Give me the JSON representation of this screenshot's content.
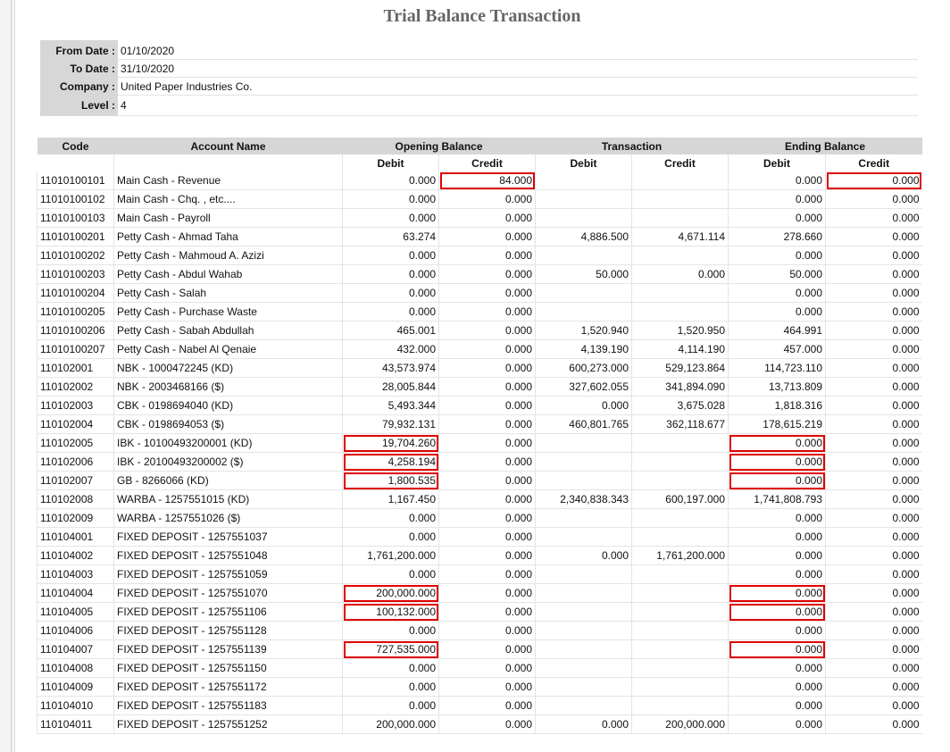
{
  "report": {
    "title": "Trial Balance Transaction"
  },
  "params": [
    {
      "label": "From Date :",
      "value": "01/10/2020"
    },
    {
      "label": "To Date :",
      "value": "31/10/2020"
    },
    {
      "label": "Company :",
      "value": "United Paper Industries Co."
    },
    {
      "label": "Level :",
      "value": "4"
    }
  ],
  "table": {
    "headers": {
      "code": "Code",
      "account": "Account Name",
      "opening": "Opening Balance",
      "transaction": "Transaction",
      "ending": "Ending Balance"
    },
    "subheaders": {
      "debit": "Debit",
      "credit": "Credit"
    },
    "rows": [
      {
        "code": "11010100101",
        "name": "Main Cash - Revenue",
        "od": "0.000",
        "oc": "84.000",
        "td": "",
        "tc": "",
        "ed": "0.000",
        "ec": "0.000"
      },
      {
        "code": "11010100102",
        "name": "Main Cash - Chq. , etc....",
        "od": "0.000",
        "oc": "0.000",
        "td": "",
        "tc": "",
        "ed": "0.000",
        "ec": "0.000"
      },
      {
        "code": "11010100103",
        "name": "Main Cash - Payroll",
        "od": "0.000",
        "oc": "0.000",
        "td": "",
        "tc": "",
        "ed": "0.000",
        "ec": "0.000"
      },
      {
        "code": "11010100201",
        "name": "Petty Cash - Ahmad Taha",
        "od": "63.274",
        "oc": "0.000",
        "td": "4,886.500",
        "tc": "4,671.114",
        "ed": "278.660",
        "ec": "0.000"
      },
      {
        "code": "11010100202",
        "name": "Petty Cash - Mahmoud A. Azizi",
        "od": "0.000",
        "oc": "0.000",
        "td": "",
        "tc": "",
        "ed": "0.000",
        "ec": "0.000"
      },
      {
        "code": "11010100203",
        "name": "Petty Cash - Abdul Wahab",
        "od": "0.000",
        "oc": "0.000",
        "td": "50.000",
        "tc": "0.000",
        "ed": "50.000",
        "ec": "0.000"
      },
      {
        "code": "11010100204",
        "name": "Petty Cash - Salah",
        "od": "0.000",
        "oc": "0.000",
        "td": "",
        "tc": "",
        "ed": "0.000",
        "ec": "0.000"
      },
      {
        "code": "11010100205",
        "name": "Petty Cash - Purchase Waste",
        "od": "0.000",
        "oc": "0.000",
        "td": "",
        "tc": "",
        "ed": "0.000",
        "ec": "0.000"
      },
      {
        "code": "11010100206",
        "name": "Petty Cash - Sabah Abdullah",
        "od": "465.001",
        "oc": "0.000",
        "td": "1,520.940",
        "tc": "1,520.950",
        "ed": "464.991",
        "ec": "0.000"
      },
      {
        "code": "11010100207",
        "name": "Petty Cash - Nabel Al Qenaie",
        "od": "432.000",
        "oc": "0.000",
        "td": "4,139.190",
        "tc": "4,114.190",
        "ed": "457.000",
        "ec": "0.000"
      },
      {
        "code": "110102001",
        "name": "NBK - 1000472245 (KD)",
        "od": "43,573.974",
        "oc": "0.000",
        "td": "600,273.000",
        "tc": "529,123.864",
        "ed": "114,723.110",
        "ec": "0.000"
      },
      {
        "code": "110102002",
        "name": "NBK - 2003468166 ($)",
        "od": "28,005.844",
        "oc": "0.000",
        "td": "327,602.055",
        "tc": "341,894.090",
        "ed": "13,713.809",
        "ec": "0.000"
      },
      {
        "code": "110102003",
        "name": "CBK - 0198694040 (KD)",
        "od": "5,493.344",
        "oc": "0.000",
        "td": "0.000",
        "tc": "3,675.028",
        "ed": "1,818.316",
        "ec": "0.000"
      },
      {
        "code": "110102004",
        "name": "CBK - 0198694053 ($)",
        "od": "79,932.131",
        "oc": "0.000",
        "td": "460,801.765",
        "tc": "362,118.677",
        "ed": "178,615.219",
        "ec": "0.000"
      },
      {
        "code": "110102005",
        "name": "IBK - 10100493200001 (KD)",
        "od": "19,704.260",
        "oc": "0.000",
        "td": "",
        "tc": "",
        "ed": "0.000",
        "ec": "0.000"
      },
      {
        "code": "110102006",
        "name": "IBK - 20100493200002 ($)",
        "od": "4,258.194",
        "oc": "0.000",
        "td": "",
        "tc": "",
        "ed": "0.000",
        "ec": "0.000"
      },
      {
        "code": "110102007",
        "name": "GB - 8266066 (KD)",
        "od": "1,800.535",
        "oc": "0.000",
        "td": "",
        "tc": "",
        "ed": "0.000",
        "ec": "0.000"
      },
      {
        "code": "110102008",
        "name": "WARBA - 1257551015 (KD)",
        "od": "1,167.450",
        "oc": "0.000",
        "td": "2,340,838.343",
        "tc": "600,197.000",
        "ed": "1,741,808.793",
        "ec": "0.000"
      },
      {
        "code": "110102009",
        "name": "WARBA - 1257551026 ($)",
        "od": "0.000",
        "oc": "0.000",
        "td": "",
        "tc": "",
        "ed": "0.000",
        "ec": "0.000"
      },
      {
        "code": "110104001",
        "name": "FIXED DEPOSIT - 1257551037",
        "od": "0.000",
        "oc": "0.000",
        "td": "",
        "tc": "",
        "ed": "0.000",
        "ec": "0.000"
      },
      {
        "code": "110104002",
        "name": "FIXED DEPOSIT - 1257551048",
        "od": "1,761,200.000",
        "oc": "0.000",
        "td": "0.000",
        "tc": "1,761,200.000",
        "ed": "0.000",
        "ec": "0.000"
      },
      {
        "code": "110104003",
        "name": "FIXED DEPOSIT - 1257551059",
        "od": "0.000",
        "oc": "0.000",
        "td": "",
        "tc": "",
        "ed": "0.000",
        "ec": "0.000"
      },
      {
        "code": "110104004",
        "name": "FIXED DEPOSIT - 1257551070",
        "od": "200,000.000",
        "oc": "0.000",
        "td": "",
        "tc": "",
        "ed": "0.000",
        "ec": "0.000"
      },
      {
        "code": "110104005",
        "name": "FIXED DEPOSIT - 1257551106",
        "od": "100,132.000",
        "oc": "0.000",
        "td": "",
        "tc": "",
        "ed": "0.000",
        "ec": "0.000"
      },
      {
        "code": "110104006",
        "name": "FIXED DEPOSIT - 1257551128",
        "od": "0.000",
        "oc": "0.000",
        "td": "",
        "tc": "",
        "ed": "0.000",
        "ec": "0.000"
      },
      {
        "code": "110104007",
        "name": "FIXED DEPOSIT - 1257551139",
        "od": "727,535.000",
        "oc": "0.000",
        "td": "",
        "tc": "",
        "ed": "0.000",
        "ec": "0.000"
      },
      {
        "code": "110104008",
        "name": "FIXED DEPOSIT - 1257551150",
        "od": "0.000",
        "oc": "0.000",
        "td": "",
        "tc": "",
        "ed": "0.000",
        "ec": "0.000"
      },
      {
        "code": "110104009",
        "name": "FIXED DEPOSIT - 1257551172",
        "od": "0.000",
        "oc": "0.000",
        "td": "",
        "tc": "",
        "ed": "0.000",
        "ec": "0.000"
      },
      {
        "code": "110104010",
        "name": "FIXED DEPOSIT - 1257551183",
        "od": "0.000",
        "oc": "0.000",
        "td": "",
        "tc": "",
        "ed": "0.000",
        "ec": "0.000"
      },
      {
        "code": "110104011",
        "name": "FIXED DEPOSIT - 1257551252",
        "od": "200,000.000",
        "oc": "0.000",
        "td": "0.000",
        "tc": "200,000.000",
        "ed": "0.000",
        "ec": "0.000"
      }
    ],
    "highlights": [
      {
        "row": 0,
        "col": "oc"
      },
      {
        "row": 0,
        "col": "ec"
      },
      {
        "row": 14,
        "col": "od"
      },
      {
        "row": 15,
        "col": "od"
      },
      {
        "row": 16,
        "col": "od"
      },
      {
        "row": 14,
        "col": "ed"
      },
      {
        "row": 15,
        "col": "ed"
      },
      {
        "row": 16,
        "col": "ed"
      },
      {
        "row": 22,
        "col": "od"
      },
      {
        "row": 23,
        "col": "od"
      },
      {
        "row": 25,
        "col": "od"
      },
      {
        "row": 22,
        "col": "ed"
      },
      {
        "row": 23,
        "col": "ed"
      },
      {
        "row": 25,
        "col": "ed"
      }
    ],
    "highlight_color": "#e00000"
  }
}
